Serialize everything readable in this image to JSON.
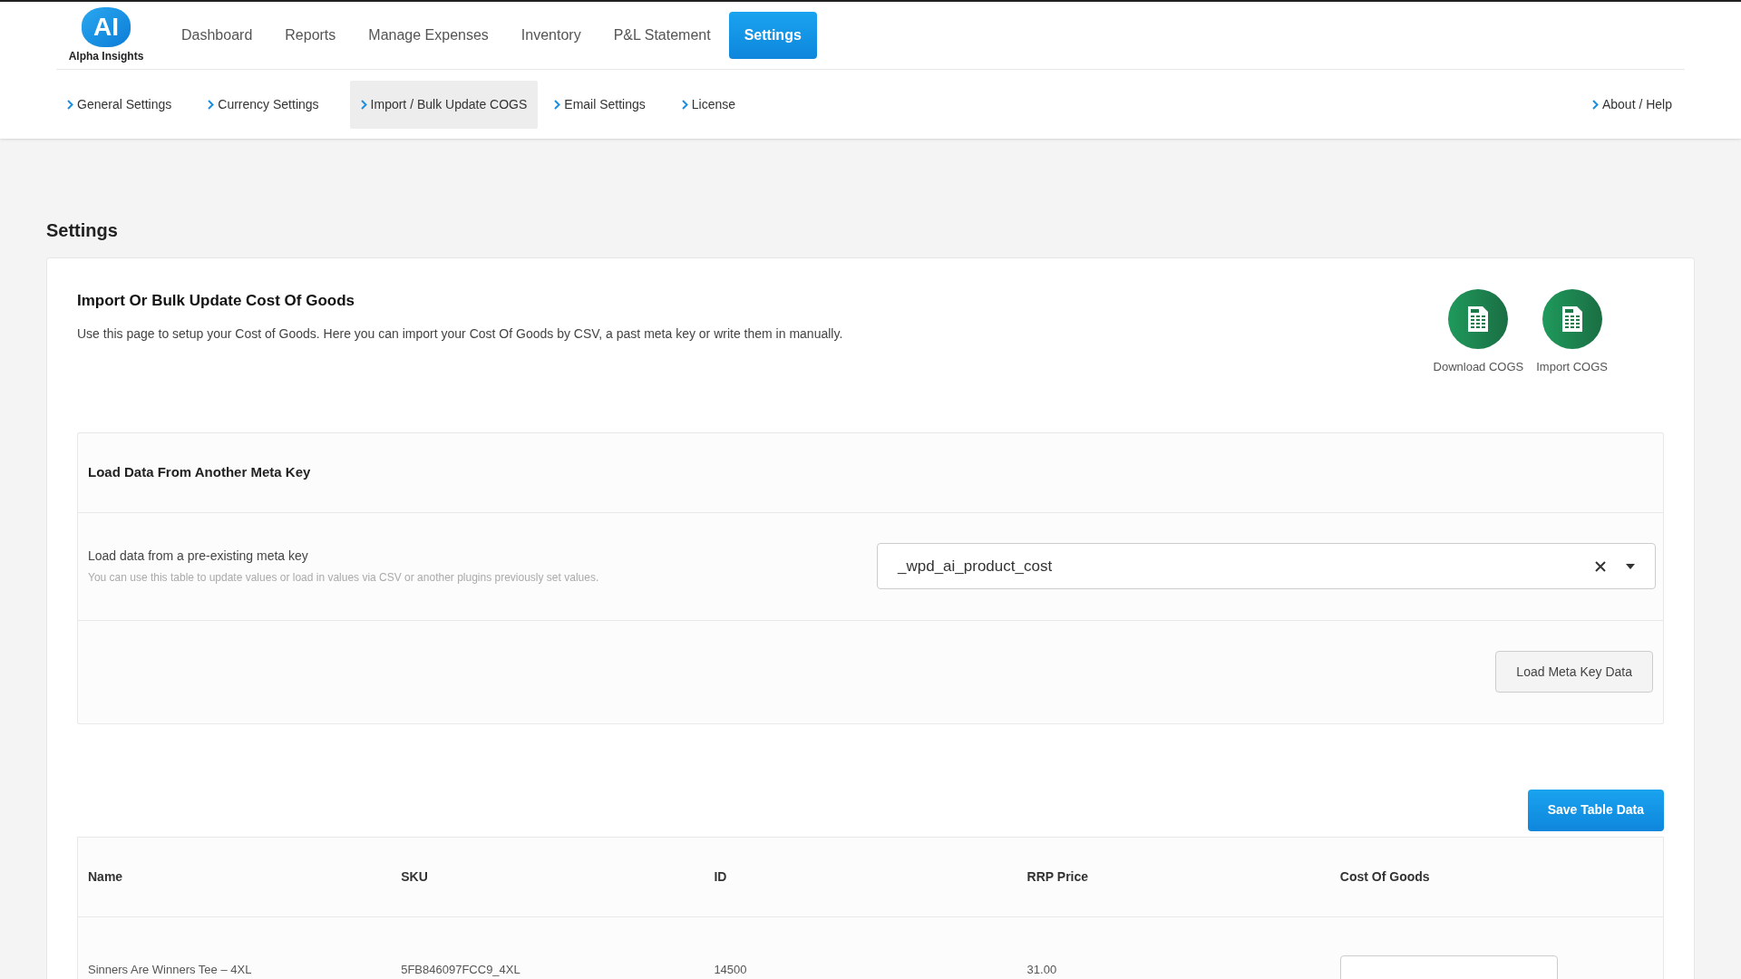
{
  "brand": {
    "logo": "AI",
    "name": "Alpha Insights"
  },
  "nav": [
    {
      "label": "Dashboard",
      "selected": false
    },
    {
      "label": "Reports",
      "selected": false
    },
    {
      "label": "Manage Expenses",
      "selected": false
    },
    {
      "label": "Inventory",
      "selected": false
    },
    {
      "label": "P&L Statement",
      "selected": false
    },
    {
      "label": "Settings",
      "selected": true
    }
  ],
  "subnav": [
    {
      "label": "General Settings",
      "selected": false
    },
    {
      "label": "Currency Settings",
      "selected": false
    },
    {
      "label": "Import / Bulk Update COGS",
      "selected": true
    },
    {
      "label": "Email Settings",
      "selected": false
    },
    {
      "label": "License",
      "selected": false
    }
  ],
  "help_link": "About / Help",
  "page_title": "Settings",
  "card": {
    "title": "Import Or Bulk Update Cost Of Goods",
    "description": "Use this page to setup your Cost of Goods. Here you can import your Cost Of Goods by CSV, a past meta key or write them in manually.",
    "actions": [
      {
        "label": "Download COGS"
      },
      {
        "label": "Import COGS"
      }
    ]
  },
  "meta_panel": {
    "title": "Load Data From Another Meta Key",
    "field_label": "Load data from a pre-existing meta key",
    "field_help": "You can use this table to update values or load in values via CSV or another plugins previously set values.",
    "select_value": "_wpd_ai_product_cost",
    "button": "Load Meta Key Data"
  },
  "save_button": "Save Table Data",
  "table": {
    "columns": [
      "Name",
      "SKU",
      "ID",
      "RRP Price",
      "Cost Of Goods"
    ],
    "rows": [
      {
        "cells": [
          "Sinners Are Winners Tee – 4XL",
          "5FB846097FCC9_4XL",
          "14500",
          "31.00"
        ]
      }
    ]
  }
}
